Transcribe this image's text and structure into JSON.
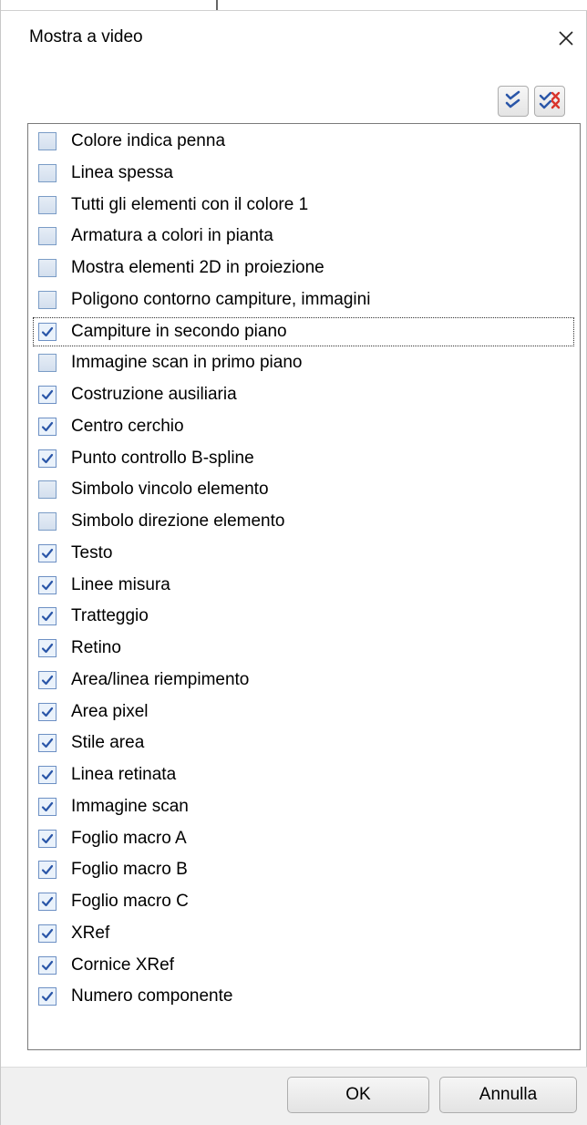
{
  "dialog": {
    "title": "Mostra a video",
    "close_icon": "close-icon",
    "toolbar": {
      "select_all_icon": "check-all-icon",
      "deselect_all_icon": "uncheck-all-icon"
    },
    "items": [
      {
        "label": "Colore indica penna",
        "checked": false
      },
      {
        "label": "Linea spessa",
        "checked": false
      },
      {
        "label": "Tutti gli elementi con il colore 1",
        "checked": false
      },
      {
        "label": "Armatura a colori in pianta",
        "checked": false
      },
      {
        "label": "Mostra elementi 2D in proiezione",
        "checked": false
      },
      {
        "label": "Poligono contorno campiture, immagini",
        "checked": false
      },
      {
        "label": "Campiture in secondo piano",
        "checked": true,
        "focused": true
      },
      {
        "label": "Immagine scan in primo piano",
        "checked": false
      },
      {
        "label": "Costruzione ausiliaria",
        "checked": true
      },
      {
        "label": "Centro cerchio",
        "checked": true
      },
      {
        "label": "Punto controllo B-spline",
        "checked": true
      },
      {
        "label": "Simbolo vincolo elemento",
        "checked": false
      },
      {
        "label": "Simbolo direzione elemento",
        "checked": false
      },
      {
        "label": "Testo",
        "checked": true
      },
      {
        "label": "Linee misura",
        "checked": true
      },
      {
        "label": "Tratteggio",
        "checked": true
      },
      {
        "label": "Retino",
        "checked": true
      },
      {
        "label": "Area/linea riempimento",
        "checked": true
      },
      {
        "label": "Area pixel",
        "checked": true
      },
      {
        "label": "Stile area",
        "checked": true
      },
      {
        "label": "Linea retinata",
        "checked": true
      },
      {
        "label": "Immagine scan",
        "checked": true
      },
      {
        "label": "Foglio macro A",
        "checked": true
      },
      {
        "label": "Foglio macro B",
        "checked": true
      },
      {
        "label": "Foglio macro C",
        "checked": true
      },
      {
        "label": "XRef",
        "checked": true
      },
      {
        "label": "Cornice XRef",
        "checked": true
      },
      {
        "label": "Numero componente",
        "checked": true
      }
    ],
    "buttons": {
      "ok_label": "OK",
      "cancel_label": "Annulla"
    }
  },
  "colors": {
    "checkmark": "#2a56a8",
    "x_mark": "#d9342b"
  }
}
